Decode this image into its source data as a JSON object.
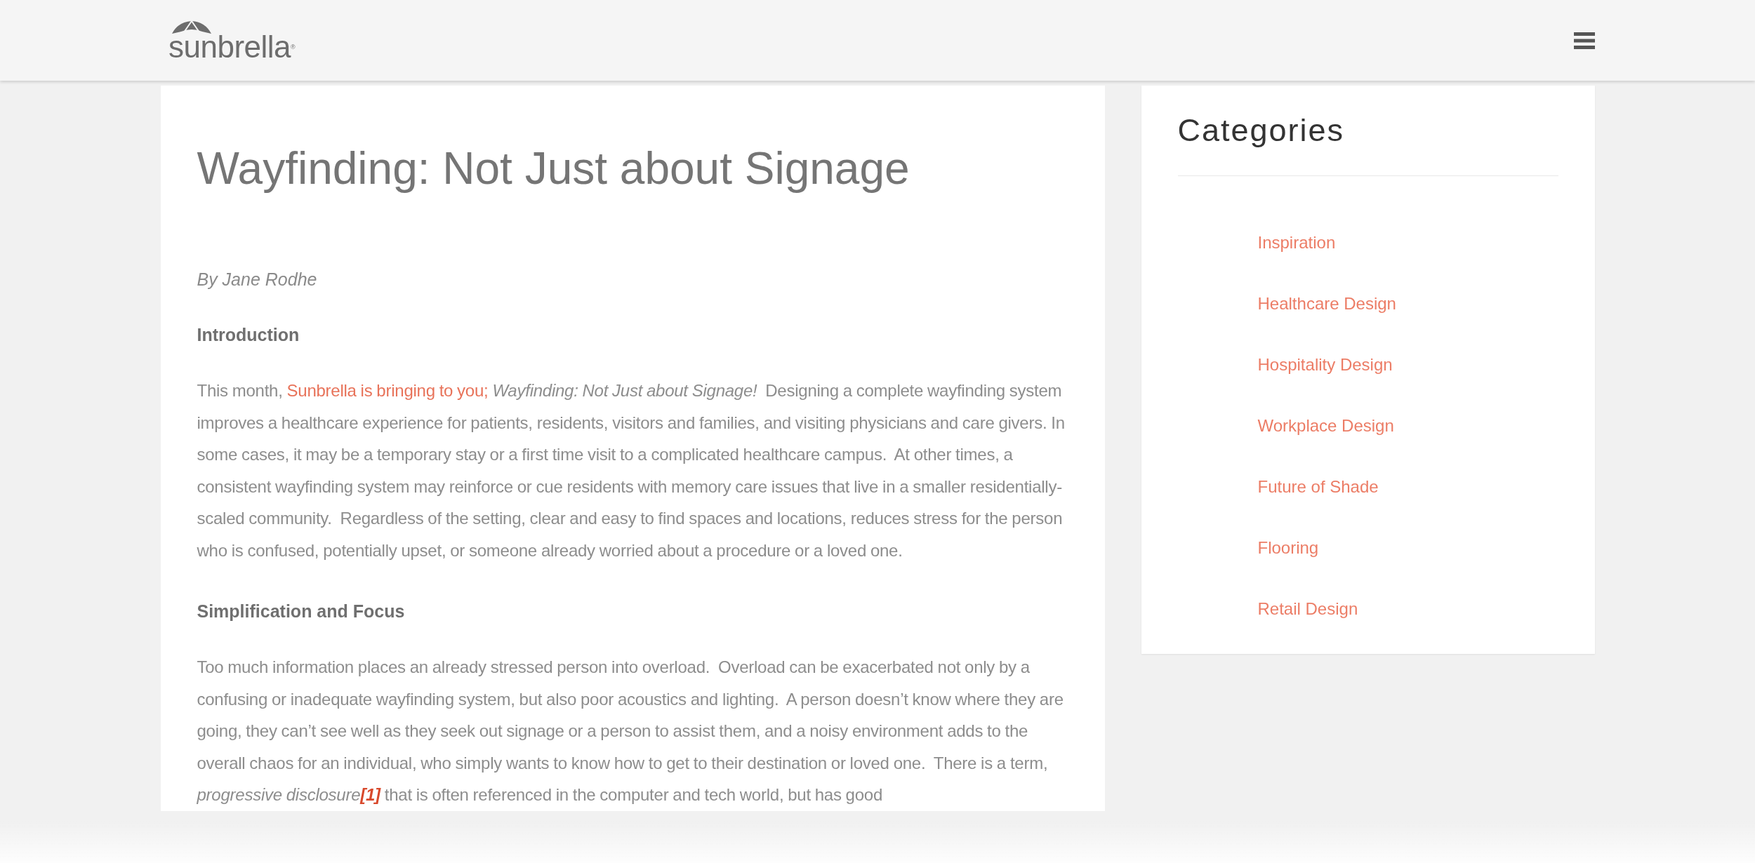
{
  "header": {
    "logo": {
      "text": "sunbrella",
      "mark": "®"
    }
  },
  "article": {
    "title": "Wayfinding: Not Just about Signage",
    "byline": "By Jane Rodhe",
    "sections": [
      {
        "heading": "Introduction",
        "paragraph": [
          {
            "kind": "plain",
            "text": "This month, "
          },
          {
            "kind": "link",
            "text": "Sunbrella is bringing to you;"
          },
          {
            "kind": "italic",
            "text": " Wayfinding: Not Just about Signage!"
          },
          {
            "kind": "plain",
            "text": "  Designing a complete wayfinding system improves a healthcare experience for patients, residents, visitors and families, and visiting physicians and care givers. In some cases, it may be a temporary stay or a first time visit to a complicated healthcare campus.  At other times, a consistent wayfinding system may reinforce or cue residents with memory care issues that live in a smaller residentially-scaled community.  Regardless of the setting, clear and easy to find spaces and locations, reduces stress for the person who is confused, potentially upset, or someone already worried about a procedure or a loved one."
          }
        ]
      },
      {
        "heading": "Simplification and Focus",
        "paragraph": [
          {
            "kind": "plain",
            "text": "Too much information places an already stressed person into overload.  Overload can be exacerbated not only by a confusing or inadequate wayfinding system, but also poor acoustics and lighting.  A person doesn’t know where they are going, they can’t see well as they seek out signage or a person to assist them, and a noisy environment adds to the overall chaos for an individual, who simply wants to know how to get to their destination or loved one.  There is a term, "
          },
          {
            "kind": "italic",
            "text": "progressive disclosure"
          },
          {
            "kind": "footnote",
            "text": "[1]"
          },
          {
            "kind": "plain",
            "text": " that is often referenced in the computer and tech world, but has good"
          }
        ]
      }
    ]
  },
  "sidebar": {
    "title": "Categories",
    "items": [
      "Inspiration",
      "Healthcare Design",
      "Hospitality Design",
      "Workplace Design",
      "Future of Shade",
      "Flooring",
      "Retail Design"
    ]
  }
}
